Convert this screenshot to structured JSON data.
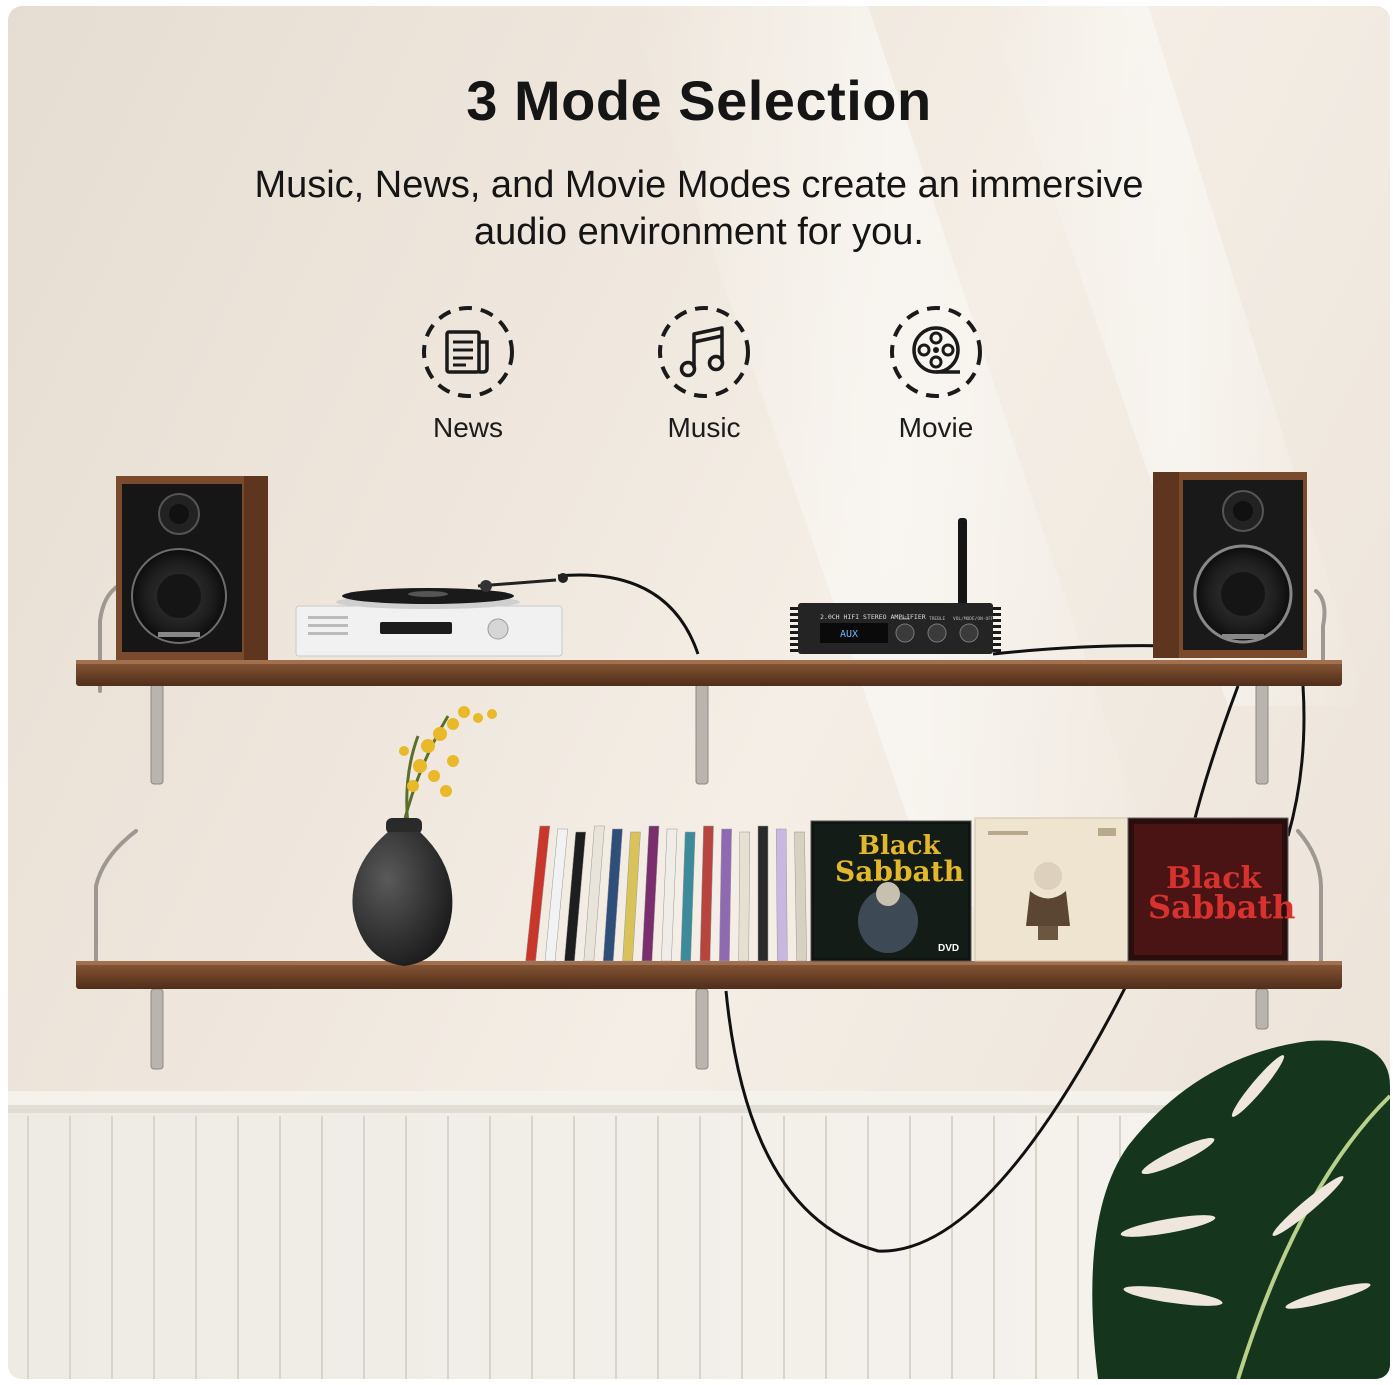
{
  "header": {
    "title": "3 Mode Selection",
    "subtitle_line1": "Music, News, and Movie Modes create an immersive",
    "subtitle_line2": "audio environment for you."
  },
  "modes": [
    {
      "label": "News",
      "icon": "newspaper-icon"
    },
    {
      "label": "Music",
      "icon": "music-note-icon"
    },
    {
      "label": "Movie",
      "icon": "film-reel-icon"
    }
  ],
  "scene": {
    "amplifier_label": "2.0CH HIFI STEREO AMPLIFIER",
    "amplifier_display": "AUX",
    "knob_labels": [
      "BASS",
      "TREBLE",
      "VOL/MODE/ON-OFF"
    ],
    "album_1": [
      "Black",
      "Sabbath"
    ],
    "album_3": [
      "Black",
      "Sabbath"
    ],
    "album_badge": "DVD"
  },
  "colors": {
    "wall": "#efe7dd",
    "wood": "#6e4328",
    "text": "#151515",
    "icon_dash": "#1a1a1a"
  }
}
